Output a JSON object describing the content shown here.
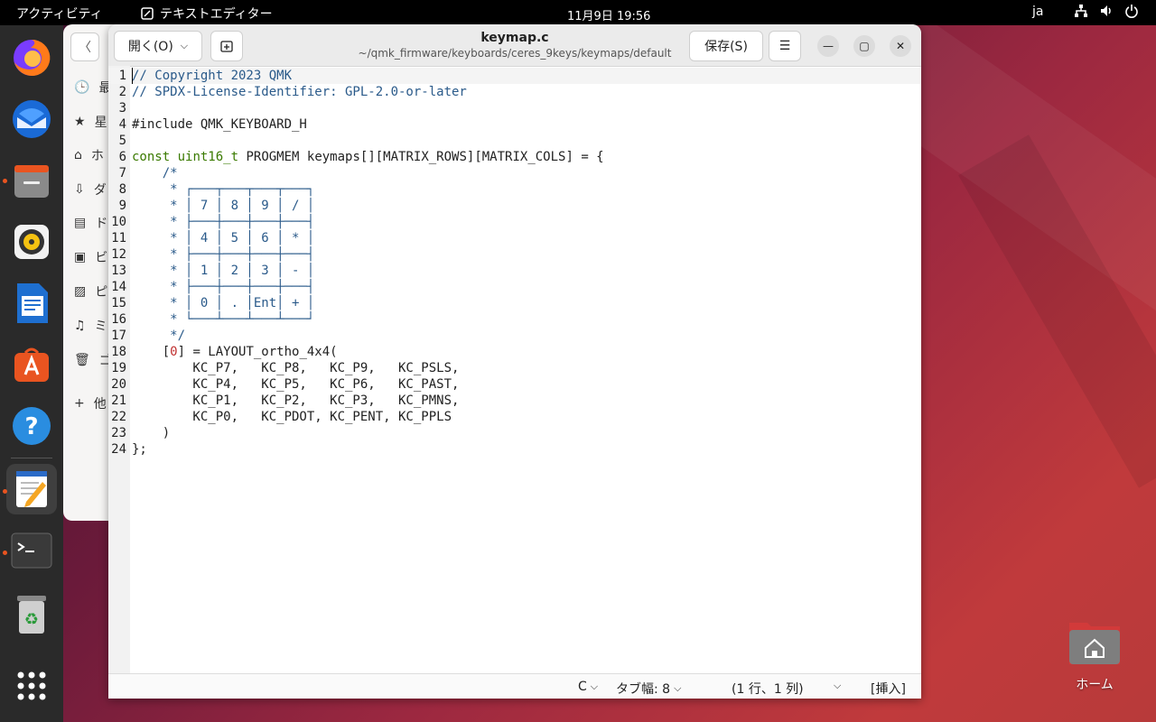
{
  "topbar": {
    "activities": "アクティビティ",
    "app_name": "テキストエディター",
    "clock": "11月9日  19:56",
    "lang": "ja"
  },
  "files_sidebar": {
    "items": [
      "最",
      "星",
      "ホ",
      "ダ",
      "ド",
      "ビ",
      "ピ",
      "ミ",
      "ゴ"
    ],
    "other": "他"
  },
  "editor": {
    "open_label": "開く(O)",
    "title": "keymap.c",
    "path": "~/qmk_firmware/keyboards/ceres_9keys/keymaps/default",
    "save_label": "保存(S)",
    "lines": [
      "// Copyright 2023 QMK",
      "// SPDX-License-Identifier: GPL-2.0-or-later",
      "",
      "#include QMK_KEYBOARD_H",
      "",
      "const uint16_t PROGMEM keymaps[][MATRIX_ROWS][MATRIX_COLS] = {",
      "    /*",
      "     * ┌───┬───┬───┬───┐",
      "     * │ 7 │ 8 │ 9 │ / │",
      "     * ├───┼───┼───┼───┤",
      "     * │ 4 │ 5 │ 6 │ * │",
      "     * ├───┼───┼───┼───┤",
      "     * │ 1 │ 2 │ 3 │ - │",
      "     * ├───┼───┼───┼───┤",
      "     * │ 0 │ . │Ent│ + │",
      "     * └───┴───┴───┴───┘",
      "     */",
      "    [0] = LAYOUT_ortho_4x4(",
      "        KC_P7,   KC_P8,   KC_P9,   KC_PSLS,",
      "        KC_P4,   KC_P5,   KC_P6,   KC_PAST,",
      "        KC_P1,   KC_P2,   KC_P3,   KC_PMNS,",
      "        KC_P0,   KC_PDOT, KC_PENT, KC_PPLS",
      "    )",
      "};"
    ],
    "status": {
      "language": "C",
      "tab_width": "タブ幅: 8",
      "position": "(1 行、1 列)",
      "mode": "[挿入]"
    }
  },
  "desktop": {
    "home_label": "ホーム"
  },
  "colors": {
    "accent": "#e95420",
    "comment": "#2a5a8a",
    "keyword": "#3a7a00"
  }
}
